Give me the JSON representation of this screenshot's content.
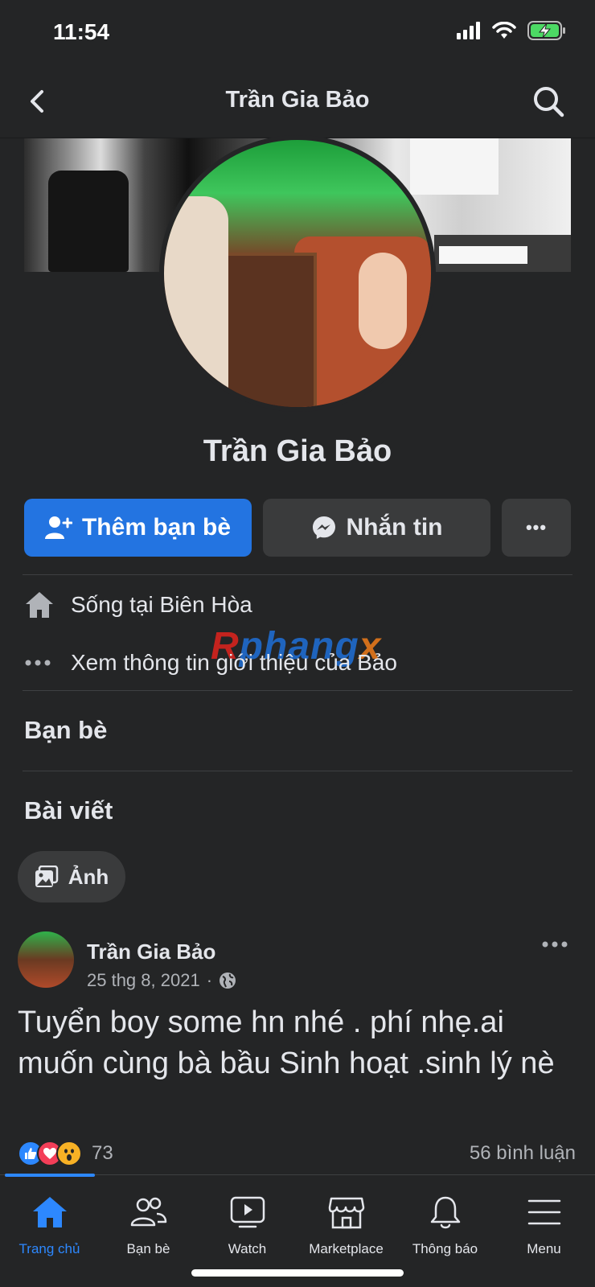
{
  "status_bar": {
    "time": "11:54"
  },
  "nav": {
    "title": "Trần Gia Bảo",
    "back_icon": "chevron-left-icon",
    "search_icon": "search-icon"
  },
  "profile": {
    "name": "Trần Gia Bảo"
  },
  "actions": {
    "add_friend": "Thêm bạn bè",
    "message": "Nhắn tin",
    "more": "•••"
  },
  "intro": {
    "lives_prefix": "Sống tại ",
    "lives_city": "Biên Hòa",
    "see_about": "Xem thông tin giới thiệu của Bảo"
  },
  "watermark": {
    "part1": "R",
    "part2": "phang",
    "part3": "x"
  },
  "sections": {
    "friends": "Bạn bè",
    "posts": "Bài viết"
  },
  "photo_chip": {
    "label": "Ảnh"
  },
  "post": {
    "author": "Trần Gia Bảo",
    "date": "25 thg 8, 2021",
    "separator": "·",
    "text": "Tuyển boy some hn nhé . phí nhẹ.ai muốn cùng bà bầu Sinh hoạt .sinh lý nè",
    "reaction_count": "73",
    "comments": "56 bình luận"
  },
  "tabbar": {
    "tabs": [
      {
        "label": "Trang chủ",
        "icon": "home-icon",
        "active": true
      },
      {
        "label": "Bạn bè",
        "icon": "friends-icon",
        "active": false
      },
      {
        "label": "Watch",
        "icon": "watch-icon",
        "active": false
      },
      {
        "label": "Marketplace",
        "icon": "marketplace-icon",
        "active": false
      },
      {
        "label": "Thông báo",
        "icon": "bell-icon",
        "active": false
      },
      {
        "label": "Menu",
        "icon": "menu-icon",
        "active": false
      }
    ]
  },
  "colors": {
    "accent": "#2374e1",
    "background": "#242526",
    "surface": "#3a3b3c",
    "active_tab": "#2d88ff"
  }
}
